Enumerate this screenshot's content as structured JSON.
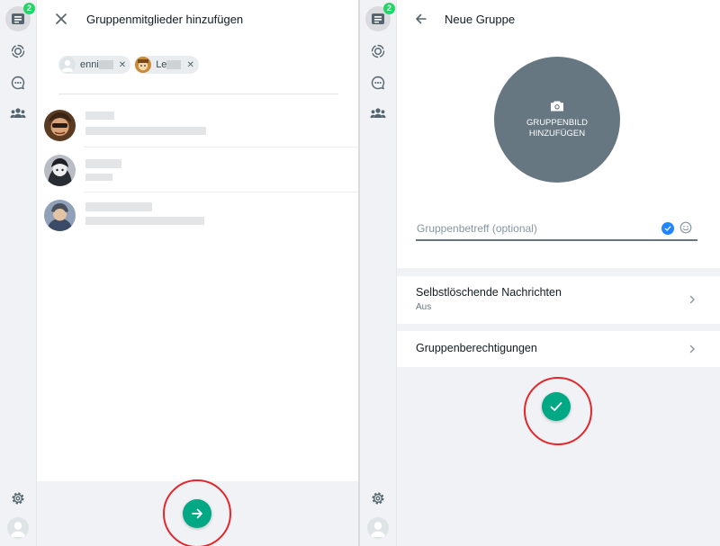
{
  "left": {
    "rail": {
      "chats_badge": "2"
    },
    "header": {
      "title": "Gruppenmitglieder hinzufügen"
    },
    "chips": [
      {
        "name": "enni"
      },
      {
        "name": "Le"
      }
    ],
    "contacts": [
      {
        "avatar": "avatar-1"
      },
      {
        "avatar": "avatar-2"
      },
      {
        "avatar": "avatar-3"
      }
    ]
  },
  "right": {
    "rail": {
      "chats_badge": "2"
    },
    "header": {
      "title": "Neue Gruppe"
    },
    "group_photo": {
      "label": "GRUPPENBILD HINZUFÜGEN"
    },
    "subject": {
      "placeholder": "Gruppenbetreff (optional)",
      "value": ""
    },
    "settings": [
      {
        "title": "Selbstlöschende Nachrichten",
        "subtitle": "Aus"
      },
      {
        "title": "Gruppenberechtigungen",
        "subtitle": ""
      }
    ]
  },
  "colors": {
    "accent": "#00a884",
    "badge": "#25d366",
    "annotation_ring": "#e3262b",
    "check_blue": "#2185ff"
  }
}
